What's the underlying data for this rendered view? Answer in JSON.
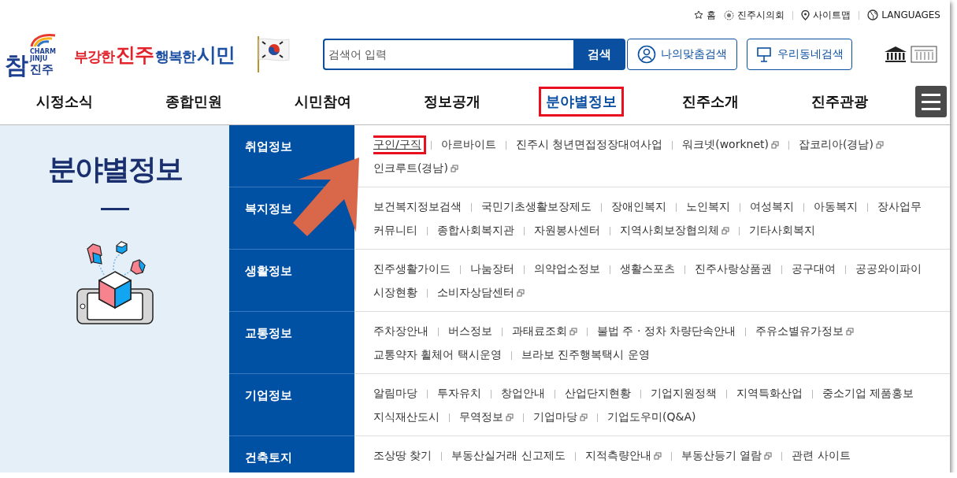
{
  "utility_links": [
    {
      "label": "홈",
      "kind": "star"
    },
    {
      "label": "진주시의회",
      "kind": "emblem"
    },
    {
      "label": "사이트맵",
      "kind": "pin"
    },
    {
      "label": "LANGUAGES",
      "kind": "globe"
    }
  ],
  "logo": {
    "top": "CHARM",
    "bottom": "JINJU",
    "mark": "참",
    "name": "진주"
  },
  "slogan": [
    {
      "text": "부강한",
      "color": "#e3232c",
      "kind": "small"
    },
    {
      "text": "진주",
      "color": "#e3232c",
      "kind": "big"
    },
    {
      "text": "행복한",
      "color": "#1d4fa3",
      "kind": "small"
    },
    {
      "text": "시민",
      "color": "#1d4fa3",
      "kind": "big"
    }
  ],
  "search": {
    "placeholder": "검색어 입력",
    "button": "검색"
  },
  "search_buttons": [
    {
      "label": "나의맞춤검색",
      "kind": "person"
    },
    {
      "label": "우리동네검색",
      "kind": "sign"
    }
  ],
  "nav": [
    {
      "label": "시정소식",
      "highlighted": false
    },
    {
      "label": "종합민원",
      "highlighted": false
    },
    {
      "label": "시민참여",
      "highlighted": false
    },
    {
      "label": "정보공개",
      "highlighted": false
    },
    {
      "label": "분야별정보",
      "highlighted": true
    },
    {
      "label": "진주소개",
      "highlighted": false
    },
    {
      "label": "진주관광",
      "highlighted": false
    }
  ],
  "sidebar": {
    "title": "분야별정보"
  },
  "categories": [
    {
      "title": "취업정보",
      "links": [
        {
          "label": "구인/구직",
          "external": false,
          "highlighted": true
        },
        {
          "label": "아르바이트",
          "external": false,
          "highlighted": false
        },
        {
          "label": "진주시 청년면접정장대여사업",
          "external": false,
          "highlighted": false
        },
        {
          "label": "워크넷(worknet)",
          "external": true,
          "highlighted": false
        },
        {
          "label": "잡코리아(경남)",
          "external": true,
          "highlighted": false
        },
        {
          "label": "인크루트(경남)",
          "external": true,
          "highlighted": false
        }
      ]
    },
    {
      "title": "복지정보",
      "links": [
        {
          "label": "보건복지정보검색",
          "external": false,
          "highlighted": false
        },
        {
          "label": "국민기초생활보장제도",
          "external": false,
          "highlighted": false
        },
        {
          "label": "장애인복지",
          "external": false,
          "highlighted": false
        },
        {
          "label": "노인복지",
          "external": false,
          "highlighted": false
        },
        {
          "label": "여성복지",
          "external": false,
          "highlighted": false
        },
        {
          "label": "아동복지",
          "external": false,
          "highlighted": false
        },
        {
          "label": "장사업무",
          "external": false,
          "highlighted": false
        },
        {
          "label": "커뮤니티",
          "external": false,
          "highlighted": false
        },
        {
          "label": "종합사회복지관",
          "external": false,
          "highlighted": false
        },
        {
          "label": "자원봉사센터",
          "external": false,
          "highlighted": false
        },
        {
          "label": "지역사회보장협의체",
          "external": true,
          "highlighted": false
        },
        {
          "label": "기타사회복지",
          "external": false,
          "highlighted": false
        }
      ]
    },
    {
      "title": "생활정보",
      "links": [
        {
          "label": "진주생활가이드",
          "external": false,
          "highlighted": false
        },
        {
          "label": "나눔장터",
          "external": false,
          "highlighted": false
        },
        {
          "label": "의약업소정보",
          "external": false,
          "highlighted": false
        },
        {
          "label": "생활스포츠",
          "external": false,
          "highlighted": false
        },
        {
          "label": "진주사랑상품권",
          "external": false,
          "highlighted": false
        },
        {
          "label": "공구대여",
          "external": false,
          "highlighted": false
        },
        {
          "label": "공공와이파이",
          "external": false,
          "highlighted": false
        },
        {
          "label": "시장현황",
          "external": false,
          "highlighted": false
        },
        {
          "label": "소비자상담센터",
          "external": true,
          "highlighted": false
        }
      ]
    },
    {
      "title": "교통정보",
      "links": [
        {
          "label": "주차장안내",
          "external": false,
          "highlighted": false
        },
        {
          "label": "버스정보",
          "external": false,
          "highlighted": false
        },
        {
          "label": "과태료조회",
          "external": true,
          "highlighted": false
        },
        {
          "label": "불법 주 · 정차 차량단속안내",
          "external": false,
          "highlighted": false
        },
        {
          "label": "주유소별유가정보",
          "external": true,
          "highlighted": false
        },
        {
          "label": "교통약자 휠체어 택시운영",
          "external": false,
          "highlighted": false
        },
        {
          "label": "브라보 진주행복택시 운영",
          "external": false,
          "highlighted": false
        }
      ]
    },
    {
      "title": "기업정보",
      "links": [
        {
          "label": "알림마당",
          "external": false,
          "highlighted": false
        },
        {
          "label": "투자유치",
          "external": false,
          "highlighted": false
        },
        {
          "label": "창업안내",
          "external": false,
          "highlighted": false
        },
        {
          "label": "산업단지현황",
          "external": false,
          "highlighted": false
        },
        {
          "label": "기업지원정책",
          "external": false,
          "highlighted": false
        },
        {
          "label": "지역특화산업",
          "external": false,
          "highlighted": false
        },
        {
          "label": "중소기업 제품홍보",
          "external": false,
          "highlighted": false
        },
        {
          "label": "지식재산도시",
          "external": false,
          "highlighted": false
        },
        {
          "label": "무역정보",
          "external": true,
          "highlighted": false
        },
        {
          "label": "기업마당",
          "external": true,
          "highlighted": false
        },
        {
          "label": "기업도우미(Q&A)",
          "external": false,
          "highlighted": false
        }
      ]
    },
    {
      "title": "건축토지",
      "links": [
        {
          "label": "조상땅 찾기",
          "external": false,
          "highlighted": false
        },
        {
          "label": "부동산실거래 신고제도",
          "external": false,
          "highlighted": false
        },
        {
          "label": "지적측량안내",
          "external": true,
          "highlighted": false
        },
        {
          "label": "부동산등기 열람",
          "external": true,
          "highlighted": false
        },
        {
          "label": "관련 사이트",
          "external": false,
          "highlighted": false
        }
      ]
    }
  ]
}
